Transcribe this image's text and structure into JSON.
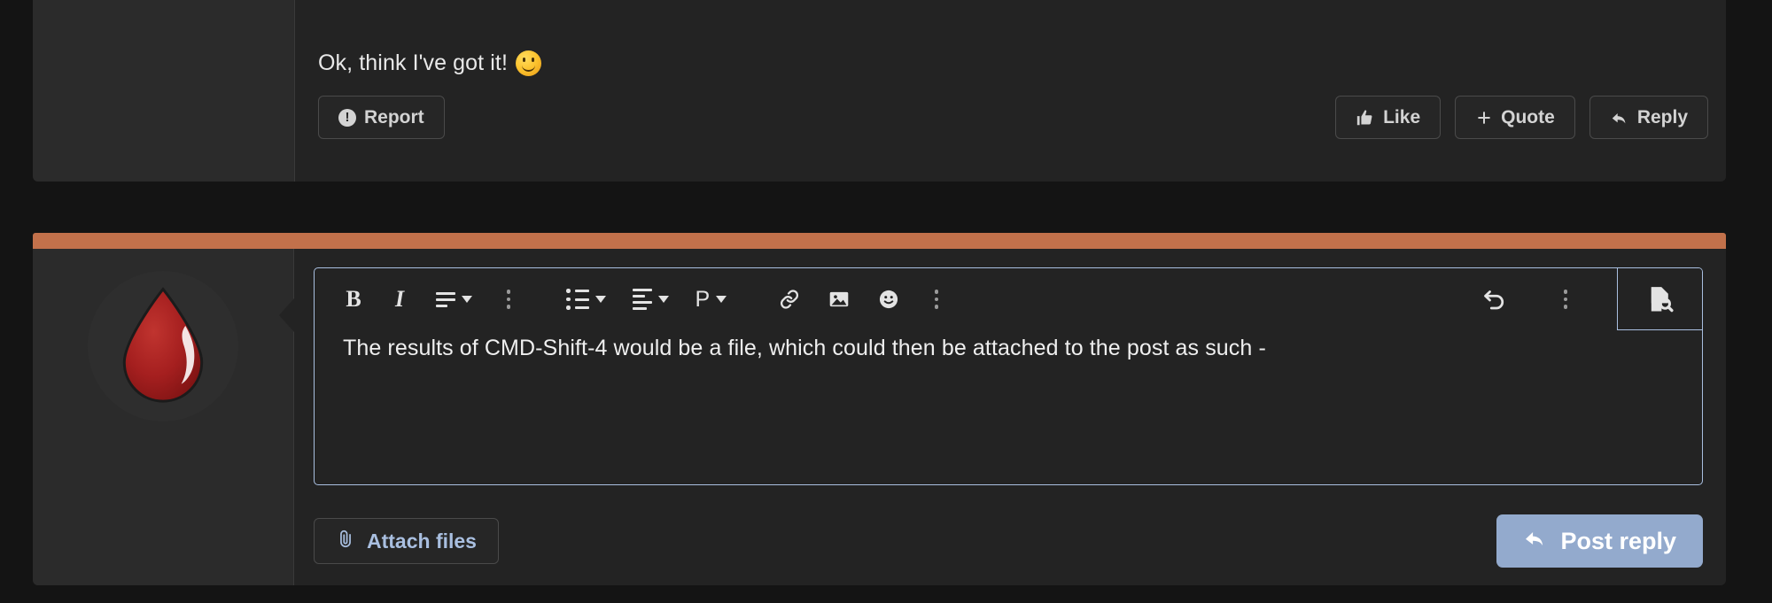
{
  "colors": {
    "page_background": "#141414",
    "card_background": "#232323",
    "aside_background": "#2b2b2b",
    "accent_bar": "#c2714b",
    "editor_border": "#a9bfe0",
    "post_button": "#93aacd",
    "attach_text": "#a9bfe0",
    "avatar_drop": "#a81f1f"
  },
  "post": {
    "body_text": "Ok, think I've got it!",
    "body_emoji": "slightly-smiling-face",
    "report_button": {
      "label": "Report",
      "icon": "exclamation-circle-icon"
    },
    "actions": [
      {
        "label": "Like",
        "icon": "thumbs-up-icon"
      },
      {
        "label": "Quote",
        "icon": "plus-icon"
      },
      {
        "label": "Reply",
        "icon": "reply-arrow-icon"
      }
    ]
  },
  "reply": {
    "avatar_alt": "blood-drop-avatar",
    "editor": {
      "content": "The results of CMD-Shift-4 would be a file, which could then be attached to the post as such -",
      "toolbar": {
        "left_items": [
          {
            "name": "bold-button",
            "label": "B",
            "kind": "text"
          },
          {
            "name": "italic-button",
            "label": "I",
            "kind": "text"
          },
          {
            "name": "text-format-dropdown",
            "label": "",
            "kind": "bars-dropdown"
          },
          {
            "name": "more-inline-options-button",
            "label": "",
            "kind": "dots"
          },
          {
            "name": "bullet-list-dropdown",
            "label": "",
            "kind": "list-dropdown"
          },
          {
            "name": "alignment-dropdown",
            "label": "",
            "kind": "align-dropdown"
          },
          {
            "name": "paragraph-style-dropdown",
            "label": "P",
            "kind": "text-dropdown"
          },
          {
            "name": "insert-link-button",
            "label": "",
            "kind": "link"
          },
          {
            "name": "insert-image-button",
            "label": "",
            "kind": "image"
          },
          {
            "name": "insert-emoji-button",
            "label": "",
            "kind": "emoji"
          },
          {
            "name": "more-insert-options-button",
            "label": "",
            "kind": "dots"
          }
        ],
        "right_items": [
          {
            "name": "undo-button",
            "label": "",
            "kind": "undo"
          },
          {
            "name": "more-editor-options-button",
            "label": "",
            "kind": "dots"
          },
          {
            "name": "preview-button",
            "label": "",
            "kind": "document-preview"
          }
        ]
      }
    },
    "attach_button": {
      "label": "Attach files",
      "icon": "paperclip-icon"
    },
    "post_button": {
      "label": "Post reply",
      "icon": "reply-arrow-icon"
    }
  }
}
